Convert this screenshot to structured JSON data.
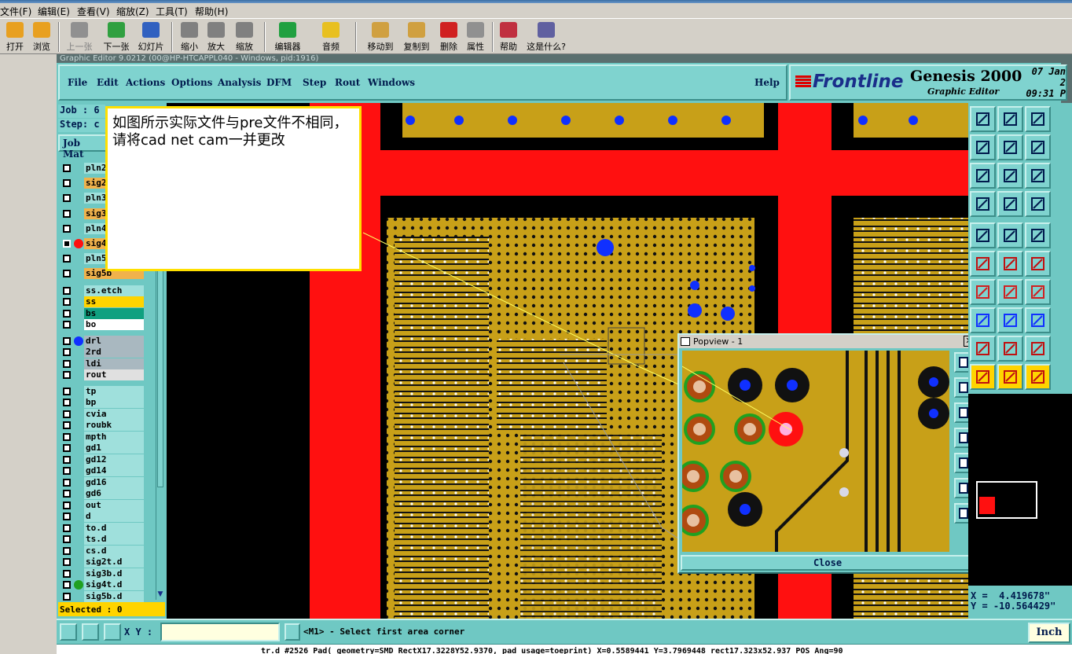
{
  "host_menu": [
    {
      "label": "文件(F)"
    },
    {
      "label": "编辑(E)"
    },
    {
      "label": "查看(V)"
    },
    {
      "label": "缩放(Z)"
    },
    {
      "label": "工具(T)"
    },
    {
      "label": "帮助(H)"
    }
  ],
  "host_toolbar": [
    {
      "label": "打开",
      "icon": "open-folder-icon"
    },
    {
      "label": "浏览",
      "icon": "browse-icon"
    },
    {
      "label": "上一张",
      "icon": "prev-image-icon"
    },
    {
      "label": "下一张",
      "icon": "next-image-icon"
    },
    {
      "label": "幻灯片",
      "icon": "slideshow-icon"
    },
    {
      "label": "缩小",
      "icon": "zoom-out-icon"
    },
    {
      "label": "放大",
      "icon": "zoom-in-icon"
    },
    {
      "label": "缩放",
      "icon": "zoom-icon"
    },
    {
      "label": "编辑器",
      "icon": "editor-icon"
    },
    {
      "label": "音频",
      "icon": "audio-icon"
    },
    {
      "label": "移动到",
      "icon": "move-to-icon"
    },
    {
      "label": "复制到",
      "icon": "copy-to-icon"
    },
    {
      "label": "删除",
      "icon": "delete-icon"
    },
    {
      "label": "属性",
      "icon": "properties-icon"
    },
    {
      "label": "帮助",
      "icon": "help-book-icon"
    },
    {
      "label": "这是什么?",
      "icon": "whats-this-icon"
    }
  ],
  "genesis": {
    "window_title": "Graphic Editor 9.0212 (00@HP-HTCAPPL040 - Windows, pid:1916)",
    "menu": [
      "File",
      "Edit",
      "Actions",
      "Options",
      "Analysis",
      "DFM",
      "Step",
      "Rout",
      "Windows"
    ],
    "help": "Help",
    "brand": {
      "logo": "Frontline",
      "product": "Genesis 2000",
      "subtitle": "Graphic Editor",
      "date": "07 Jan 2",
      "time": "09:31 P"
    },
    "job_label": "Job  :  6",
    "step_label": "Step:  c",
    "job_matrix": "Job Mat",
    "layers": [
      {
        "name": "pln2",
        "bg": "#9fe0dc",
        "dot": ""
      },
      {
        "name": "sig2",
        "bg": "#f0b24c",
        "dot": ""
      },
      {
        "name": "pln3",
        "bg": "#9fe0dc",
        "dot": ""
      },
      {
        "name": "sig3",
        "bg": "#f0b24c",
        "dot": ""
      },
      {
        "name": "pln4",
        "bg": "#9fe0dc",
        "dot": ""
      },
      {
        "name": "sig4",
        "bg": "#f0b24c",
        "dot": "#ff1010",
        "active": true
      },
      {
        "name": "pln5",
        "bg": "#9fe0dc",
        "dot": ""
      },
      {
        "name": "sig5b",
        "bg": "#f0b24c",
        "dot": ""
      },
      {
        "name": "ss.etch",
        "bg": "#9fe0dc",
        "dot": ""
      },
      {
        "name": "ss",
        "bg": "#ffd400",
        "dot": ""
      },
      {
        "name": "bs",
        "bg": "#10a080",
        "dot": ""
      },
      {
        "name": "bo",
        "bg": "#ffffff",
        "dot": ""
      },
      {
        "name": "drl",
        "bg": "#a9b8c0",
        "dot": "#1030ff"
      },
      {
        "name": "2rd",
        "bg": "#a9b8c0",
        "dot": ""
      },
      {
        "name": "ldi",
        "bg": "#a9b8c0",
        "dot": ""
      },
      {
        "name": "rout",
        "bg": "#e0e0e0",
        "dot": ""
      },
      {
        "name": "tp",
        "bg": "#9fe0dc",
        "dot": ""
      },
      {
        "name": "bp",
        "bg": "#9fe0dc",
        "dot": ""
      },
      {
        "name": "cvia",
        "bg": "#9fe0dc",
        "dot": ""
      },
      {
        "name": "roubk",
        "bg": "#9fe0dc",
        "dot": ""
      },
      {
        "name": "mpth",
        "bg": "#9fe0dc",
        "dot": ""
      },
      {
        "name": "gd1",
        "bg": "#9fe0dc",
        "dot": ""
      },
      {
        "name": "gd12",
        "bg": "#9fe0dc",
        "dot": ""
      },
      {
        "name": "gd14",
        "bg": "#9fe0dc",
        "dot": ""
      },
      {
        "name": "gd16",
        "bg": "#9fe0dc",
        "dot": ""
      },
      {
        "name": "gd6",
        "bg": "#9fe0dc",
        "dot": ""
      },
      {
        "name": "out",
        "bg": "#9fe0dc",
        "dot": ""
      },
      {
        "name": "d",
        "bg": "#9fe0dc",
        "dot": ""
      },
      {
        "name": "to.d",
        "bg": "#9fe0dc",
        "dot": ""
      },
      {
        "name": "ts.d",
        "bg": "#9fe0dc",
        "dot": ""
      },
      {
        "name": "cs.d",
        "bg": "#9fe0dc",
        "dot": ""
      },
      {
        "name": "sig2t.d",
        "bg": "#9fe0dc",
        "dot": ""
      },
      {
        "name": "sig3b.d",
        "bg": "#9fe0dc",
        "dot": ""
      },
      {
        "name": "sig4t.d",
        "bg": "#9fe0dc",
        "dot": "#20a020"
      },
      {
        "name": "sig5b.d",
        "bg": "#9fe0dc",
        "dot": ""
      }
    ],
    "selected": "Selected : 0",
    "annotation": "如图所示实际文件与pre文件不相同，请将cad net cam一并更改",
    "popview": {
      "title": "Popview - 1",
      "close": "Close"
    },
    "coords": {
      "x": "X =  4.419678\"",
      "y": "Y = -10.564429\""
    },
    "xy_label": "X Y :",
    "xy_value": "",
    "message": "<M1> - Select first area corner",
    "units": "Inch",
    "status_line": "tr.d #2526 Pad( geometry=SMD_RectX17.3228Y52.9370, pad usage=toeprint) X=0.5589441 Y=3.7969448 rect17.323x52.937 POS Ang=90",
    "colors": {
      "panel": "#6fc8c3",
      "copper": "#c8a018",
      "red_layer": "#ff1010",
      "background": "#000000"
    }
  }
}
